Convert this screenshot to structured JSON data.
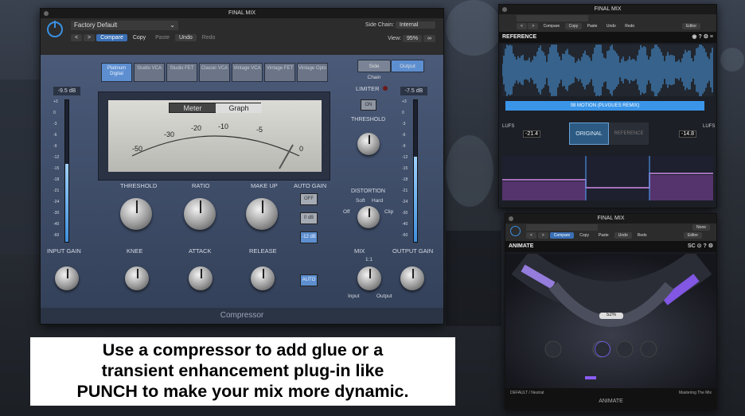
{
  "compressor": {
    "title": "FINAL MIX",
    "preset": "Factory Default",
    "side_chain_label": "Side Chain:",
    "side_chain_value": "Internal",
    "view_label": "View:",
    "view_value": "95%",
    "buttons": {
      "compare": "Compare",
      "copy": "Copy",
      "paste": "Paste",
      "undo": "Undo",
      "redo": "Redo",
      "prev": "<",
      "next": ">"
    },
    "models": [
      {
        "label": "Platinum Digital",
        "active": true
      },
      {
        "label": "Studio VCA",
        "active": false
      },
      {
        "label": "Studio FET",
        "active": false
      },
      {
        "label": "Classic VCA",
        "active": false
      },
      {
        "label": "Vintage VCA",
        "active": false
      },
      {
        "label": "Vintage FET",
        "active": false
      },
      {
        "label": "Vintage Opto",
        "active": false
      }
    ],
    "side_chain_btn": "Side Chain",
    "output_btn": "Output",
    "meter_tab": "Meter",
    "graph_tab": "Graph",
    "meter_scale": [
      "-50",
      "-30",
      "-20",
      "-10",
      "-5",
      "0"
    ],
    "input_level": "-9.5 dB",
    "output_level": "-7.5 dB",
    "input_fill": 0.55,
    "output_fill": 0.6,
    "meter_ticks": [
      "+3",
      "0",
      "-3",
      "-6",
      "-9",
      "-12",
      "-15",
      "-18",
      "-21",
      "-24",
      "-30",
      "-40",
      "-60"
    ],
    "knobs": {
      "threshold": "THRESHOLD",
      "ratio": "RATIO",
      "makeup": "MAKE UP",
      "knee": "KNEE",
      "attack": "ATTACK",
      "release": "RELEASE",
      "input_gain": "INPUT GAIN",
      "output_gain": "OUTPUT GAIN",
      "mix": "MIX",
      "distortion": "DISTORTION"
    },
    "auto_gain": "AUTO GAIN",
    "auto_gain_opts": [
      "OFF",
      "0 dB",
      "-12 dB"
    ],
    "auto_btn": "AUTO",
    "limiter": "LIMITER",
    "limiter_on": "ON",
    "limiter_threshold": "THRESHOLD",
    "dist_opts": [
      "Off",
      "Soft",
      "Hard",
      "Clip"
    ],
    "mix_ratio": "1:1",
    "mix_ends": [
      "Input",
      "Output"
    ],
    "footer": "Compressor"
  },
  "reference": {
    "title": "FINAL MIX",
    "header": "REFERENCE",
    "track_bar": "08 MOTION (PLVGUES REMIX)",
    "original": "ORIGINAL",
    "reference_btn": "REFERENCE",
    "lufs_left": "-21.4",
    "lufs_right": "-14.8",
    "lufs": "LUFS",
    "buttons": {
      "compare": "Compare",
      "copy": "Copy",
      "paste": "Paste",
      "undo": "Undo",
      "redo": "Redo"
    },
    "view_value": "Editor"
  },
  "animate": {
    "title": "FINAL MIX",
    "header": "ANIMATE",
    "side_chain_value": "None",
    "view_value": "Editor",
    "percent": "52%",
    "footer": "ANIMATE",
    "preset": "DEFAULT / Neutral",
    "brand": "Mastering The Mix",
    "buttons": {
      "compare": "Compare",
      "copy": "Copy",
      "paste": "Paste",
      "undo": "Undo",
      "redo": "Redo"
    }
  },
  "caption": {
    "line1": "Use a compressor to add glue or a",
    "line2": "transient enhancement plug-in like",
    "line3": "PUNCH to make your mix more dynamic."
  }
}
